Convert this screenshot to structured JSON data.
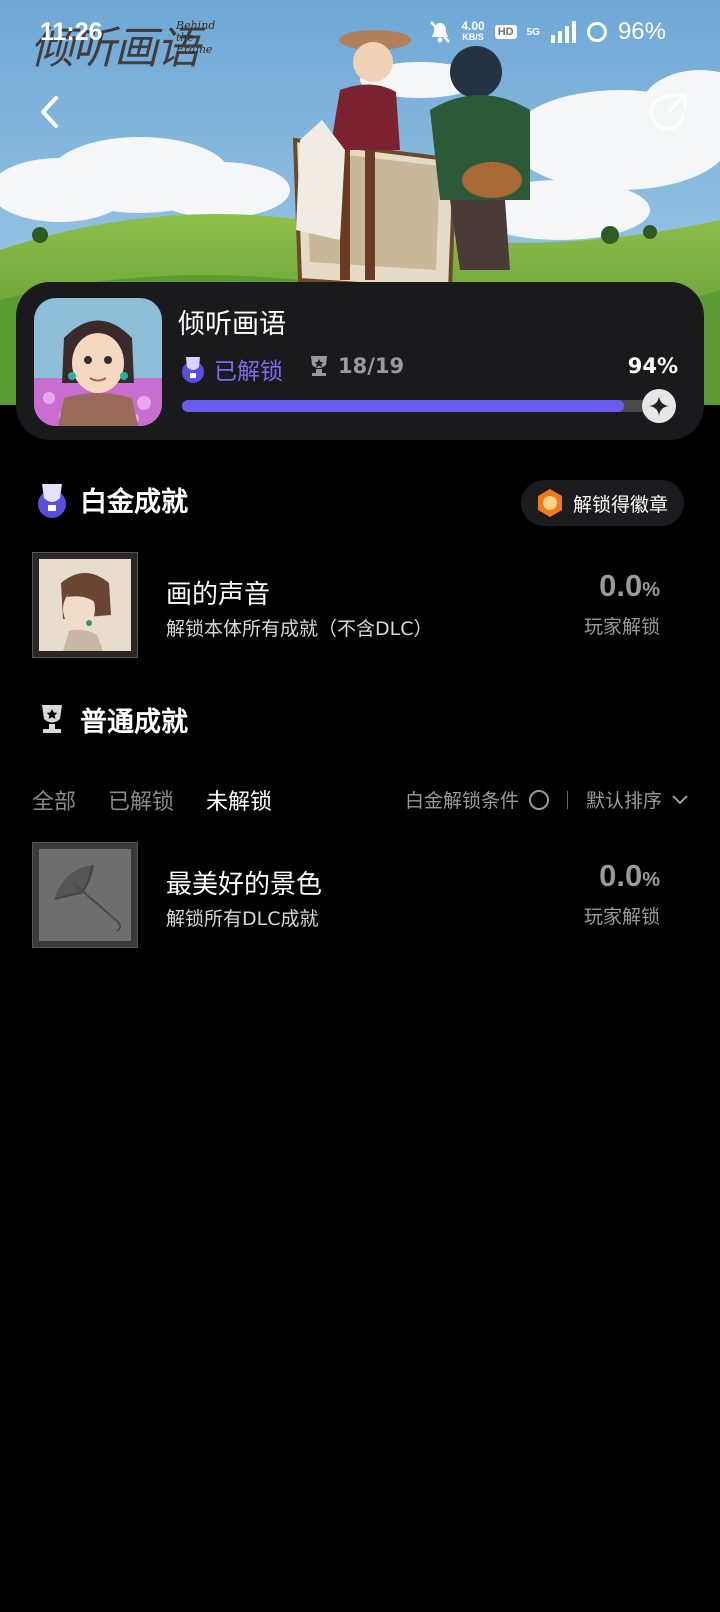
{
  "status_bar": {
    "time": "11:26",
    "net_speed_value": "4.00",
    "net_speed_unit": "KB/S",
    "hd_label": "HD",
    "network_type": "5G",
    "battery": "96%"
  },
  "hero": {
    "logo_text": "倾听画语",
    "logo_subtitle": "Behind the Frame"
  },
  "game": {
    "title": "倾听画语",
    "unlock_status": "已解锁",
    "trophy_count": "18/19",
    "percent": "94%",
    "progress": 0.94
  },
  "platinum": {
    "header": "白金成就",
    "badge_button": "解锁得徽章",
    "items": [
      {
        "name": "画的声音",
        "desc": "解锁本体所有成就（不含DLC）",
        "rate": "0.0",
        "rate_unit": "%",
        "rate_label": "玩家解锁"
      }
    ]
  },
  "normal": {
    "header": "普通成就",
    "tabs": [
      "全部",
      "已解锁",
      "未解锁"
    ],
    "active_tab": 2,
    "condition_label": "白金解锁条件",
    "sort_label": "默认排序",
    "items": [
      {
        "name": "最美好的景色",
        "desc": "解锁所有DLC成就",
        "rate": "0.0",
        "rate_unit": "%",
        "rate_label": "玩家解锁"
      }
    ]
  },
  "colors": {
    "accent": "#6a5cf0",
    "card_bg": "#1a1a1c",
    "muted": "#9a9a9a"
  }
}
